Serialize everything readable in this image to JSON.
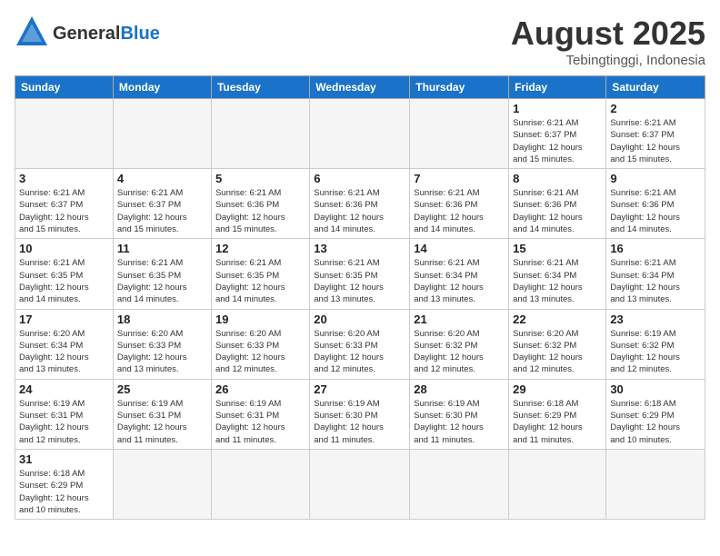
{
  "header": {
    "month_year": "August 2025",
    "location": "Tebingtinggi, Indonesia",
    "logo_general": "General",
    "logo_blue": "Blue"
  },
  "weekdays": [
    "Sunday",
    "Monday",
    "Tuesday",
    "Wednesday",
    "Thursday",
    "Friday",
    "Saturday"
  ],
  "weeks": [
    [
      {
        "day": "",
        "info": ""
      },
      {
        "day": "",
        "info": ""
      },
      {
        "day": "",
        "info": ""
      },
      {
        "day": "",
        "info": ""
      },
      {
        "day": "",
        "info": ""
      },
      {
        "day": "1",
        "info": "Sunrise: 6:21 AM\nSunset: 6:37 PM\nDaylight: 12 hours\nand 15 minutes."
      },
      {
        "day": "2",
        "info": "Sunrise: 6:21 AM\nSunset: 6:37 PM\nDaylight: 12 hours\nand 15 minutes."
      }
    ],
    [
      {
        "day": "3",
        "info": "Sunrise: 6:21 AM\nSunset: 6:37 PM\nDaylight: 12 hours\nand 15 minutes."
      },
      {
        "day": "4",
        "info": "Sunrise: 6:21 AM\nSunset: 6:37 PM\nDaylight: 12 hours\nand 15 minutes."
      },
      {
        "day": "5",
        "info": "Sunrise: 6:21 AM\nSunset: 6:36 PM\nDaylight: 12 hours\nand 15 minutes."
      },
      {
        "day": "6",
        "info": "Sunrise: 6:21 AM\nSunset: 6:36 PM\nDaylight: 12 hours\nand 14 minutes."
      },
      {
        "day": "7",
        "info": "Sunrise: 6:21 AM\nSunset: 6:36 PM\nDaylight: 12 hours\nand 14 minutes."
      },
      {
        "day": "8",
        "info": "Sunrise: 6:21 AM\nSunset: 6:36 PM\nDaylight: 12 hours\nand 14 minutes."
      },
      {
        "day": "9",
        "info": "Sunrise: 6:21 AM\nSunset: 6:36 PM\nDaylight: 12 hours\nand 14 minutes."
      }
    ],
    [
      {
        "day": "10",
        "info": "Sunrise: 6:21 AM\nSunset: 6:35 PM\nDaylight: 12 hours\nand 14 minutes."
      },
      {
        "day": "11",
        "info": "Sunrise: 6:21 AM\nSunset: 6:35 PM\nDaylight: 12 hours\nand 14 minutes."
      },
      {
        "day": "12",
        "info": "Sunrise: 6:21 AM\nSunset: 6:35 PM\nDaylight: 12 hours\nand 14 minutes."
      },
      {
        "day": "13",
        "info": "Sunrise: 6:21 AM\nSunset: 6:35 PM\nDaylight: 12 hours\nand 13 minutes."
      },
      {
        "day": "14",
        "info": "Sunrise: 6:21 AM\nSunset: 6:34 PM\nDaylight: 12 hours\nand 13 minutes."
      },
      {
        "day": "15",
        "info": "Sunrise: 6:21 AM\nSunset: 6:34 PM\nDaylight: 12 hours\nand 13 minutes."
      },
      {
        "day": "16",
        "info": "Sunrise: 6:21 AM\nSunset: 6:34 PM\nDaylight: 12 hours\nand 13 minutes."
      }
    ],
    [
      {
        "day": "17",
        "info": "Sunrise: 6:20 AM\nSunset: 6:34 PM\nDaylight: 12 hours\nand 13 minutes."
      },
      {
        "day": "18",
        "info": "Sunrise: 6:20 AM\nSunset: 6:33 PM\nDaylight: 12 hours\nand 13 minutes."
      },
      {
        "day": "19",
        "info": "Sunrise: 6:20 AM\nSunset: 6:33 PM\nDaylight: 12 hours\nand 12 minutes."
      },
      {
        "day": "20",
        "info": "Sunrise: 6:20 AM\nSunset: 6:33 PM\nDaylight: 12 hours\nand 12 minutes."
      },
      {
        "day": "21",
        "info": "Sunrise: 6:20 AM\nSunset: 6:32 PM\nDaylight: 12 hours\nand 12 minutes."
      },
      {
        "day": "22",
        "info": "Sunrise: 6:20 AM\nSunset: 6:32 PM\nDaylight: 12 hours\nand 12 minutes."
      },
      {
        "day": "23",
        "info": "Sunrise: 6:19 AM\nSunset: 6:32 PM\nDaylight: 12 hours\nand 12 minutes."
      }
    ],
    [
      {
        "day": "24",
        "info": "Sunrise: 6:19 AM\nSunset: 6:31 PM\nDaylight: 12 hours\nand 12 minutes."
      },
      {
        "day": "25",
        "info": "Sunrise: 6:19 AM\nSunset: 6:31 PM\nDaylight: 12 hours\nand 11 minutes."
      },
      {
        "day": "26",
        "info": "Sunrise: 6:19 AM\nSunset: 6:31 PM\nDaylight: 12 hours\nand 11 minutes."
      },
      {
        "day": "27",
        "info": "Sunrise: 6:19 AM\nSunset: 6:30 PM\nDaylight: 12 hours\nand 11 minutes."
      },
      {
        "day": "28",
        "info": "Sunrise: 6:19 AM\nSunset: 6:30 PM\nDaylight: 12 hours\nand 11 minutes."
      },
      {
        "day": "29",
        "info": "Sunrise: 6:18 AM\nSunset: 6:29 PM\nDaylight: 12 hours\nand 11 minutes."
      },
      {
        "day": "30",
        "info": "Sunrise: 6:18 AM\nSunset: 6:29 PM\nDaylight: 12 hours\nand 10 minutes."
      }
    ],
    [
      {
        "day": "31",
        "info": "Sunrise: 6:18 AM\nSunset: 6:29 PM\nDaylight: 12 hours\nand 10 minutes."
      },
      {
        "day": "",
        "info": ""
      },
      {
        "day": "",
        "info": ""
      },
      {
        "day": "",
        "info": ""
      },
      {
        "day": "",
        "info": ""
      },
      {
        "day": "",
        "info": ""
      },
      {
        "day": "",
        "info": ""
      }
    ]
  ]
}
